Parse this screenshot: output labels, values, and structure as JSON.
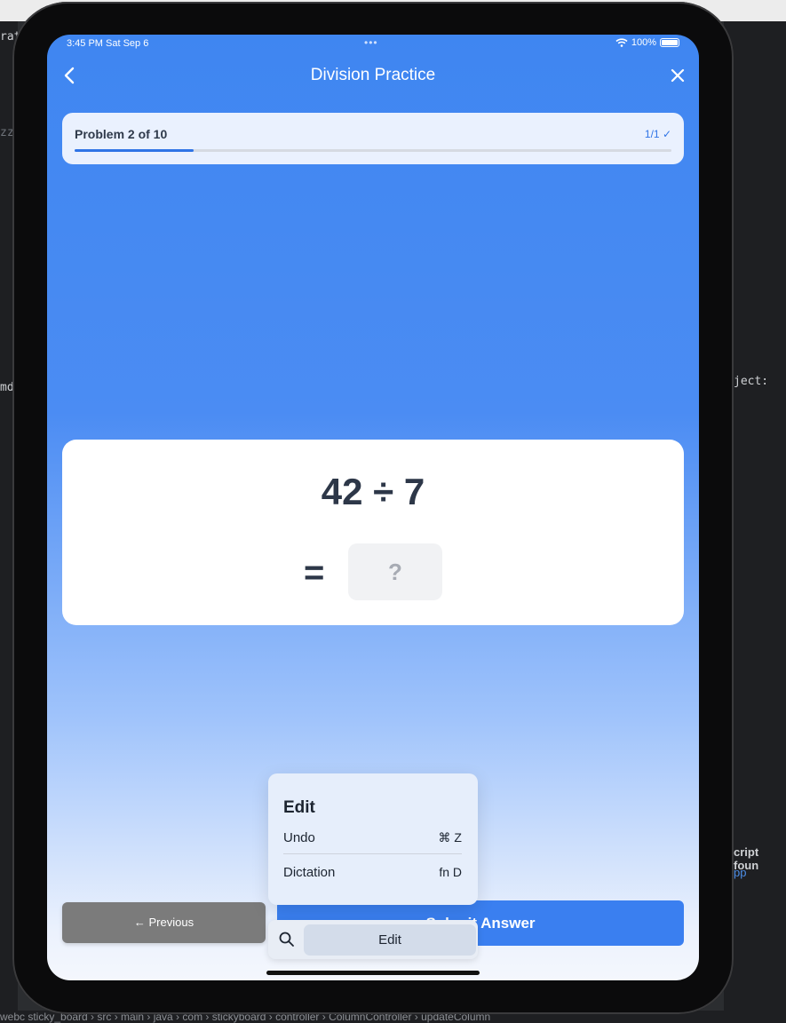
{
  "status_bar": {
    "time": "3:45 PM   Sat Sep 6",
    "dots": "•••",
    "battery": "100%"
  },
  "nav": {
    "title": "Division Practice",
    "back_glyph": "‹",
    "close_glyph": "✕"
  },
  "progress": {
    "label": "Problem 2 of 10",
    "count": "1/1 ✓",
    "fraction": 0.2
  },
  "problem": {
    "expression": "42 ÷ 7",
    "equals": "=",
    "answer_placeholder": "?"
  },
  "edit_menu": {
    "title": "Edit",
    "items": [
      {
        "label": "Undo",
        "shortcut": "⌘ Z"
      },
      {
        "label": "Dictation",
        "shortcut": "fn D"
      }
    ]
  },
  "buttons": {
    "previous": "← Previous",
    "submit": "Submit Answer"
  },
  "edit_bar": {
    "button": "Edit"
  },
  "ide": {
    "left_texts": [
      "rat",
      "zz",
      "md"
    ],
    "right_texts": [
      "ject:",
      "cript foun",
      "pp"
    ],
    "bottom": "webc  sticky_board › src › main › java › com › stickyboard › controller › ColumnController › updateColumn"
  },
  "colors": {
    "accent": "#3a7ff0",
    "screen_top": "#3f86f1",
    "previous_button": "#7b7b7b"
  }
}
